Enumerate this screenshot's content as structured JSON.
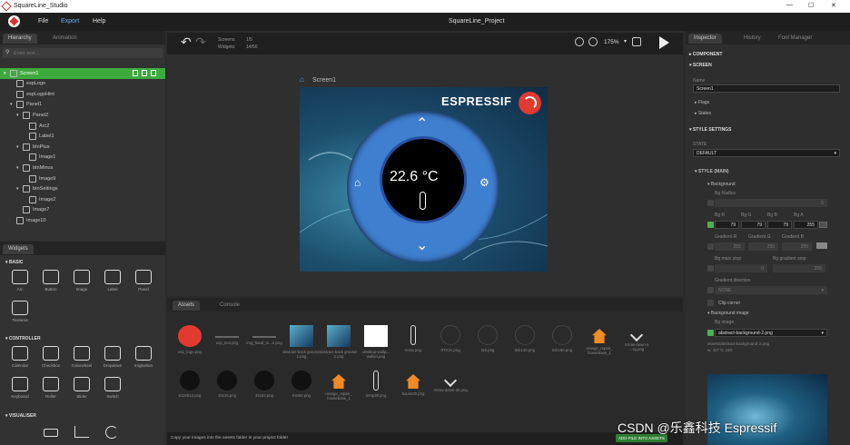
{
  "app": {
    "title": "SquareLine_Studio",
    "project": "SquareLine_Project",
    "menu": [
      "File",
      "Export",
      "Help"
    ]
  },
  "window": {
    "min": "—",
    "max": "☐",
    "close": "✕"
  },
  "left": {
    "tabs": [
      "Hierarchy",
      "Animation"
    ],
    "search_placeholder": "Enter text...",
    "tree": [
      {
        "label": "Screen1",
        "depth": 0,
        "selected": true
      },
      {
        "label": "espLogo",
        "depth": 1
      },
      {
        "label": "espLogoHint",
        "depth": 1
      },
      {
        "label": "Panel1",
        "depth": 1
      },
      {
        "label": "Panel2",
        "depth": 2
      },
      {
        "label": "Arc2",
        "depth": 3
      },
      {
        "label": "Label1",
        "depth": 3
      },
      {
        "label": "btnPlus",
        "depth": 2
      },
      {
        "label": "Image1",
        "depth": 3
      },
      {
        "label": "btnMinus",
        "depth": 2
      },
      {
        "label": "Image9",
        "depth": 3
      },
      {
        "label": "btnSettings",
        "depth": 2
      },
      {
        "label": "Image2",
        "depth": 3
      },
      {
        "label": "Image7",
        "depth": 2
      },
      {
        "label": "Image10",
        "depth": 1
      }
    ],
    "widgets_tab": "Widgets",
    "sections": {
      "basic": "BASIC",
      "controller": "CONTROLLER",
      "visualiser": "VISUALISER"
    },
    "basic": [
      "Arc",
      "Button",
      "Image",
      "Label",
      "Panel",
      "Textarea"
    ],
    "controller": [
      "Calendar",
      "Checkbox",
      "Colorwheel",
      "Dropdown",
      "Imgbutton",
      "Keyboard",
      "Roller",
      "Slider",
      "Switch"
    ]
  },
  "toolbar": {
    "screens_label": "Screens:",
    "screens_val": "1/5",
    "widgets_label": "Widgets:",
    "widgets_val": "14/50",
    "zoom": "175%"
  },
  "canvas": {
    "screen_name": "Screen1",
    "brand": "ESPRESSIF",
    "temp": "22.6 °C"
  },
  "assets": {
    "tabs": [
      "Assets",
      "Console"
    ],
    "row1": [
      "esp_logo.png",
      "esp_text.png",
      "img_hand_m...n.png",
      "abstract-back ground-1.png",
      "abstract-back ground-2.png",
      "desktop-wallp... walker.png",
      "temp.png",
      "RTICK.png",
      "tick.png",
      "tick140.png",
      "tick150.png",
      "orange_repair_ housebase_1",
      "Arrow-down-s ...vg.png"
    ],
    "row2": [
      "512x512.png",
      "16x16.png",
      "32x32.png",
      "64x64.png",
      "orange_repair_ housebase_1",
      "temp30.png",
      "house30.png",
      "Arrow-down-30.png"
    ],
    "hint": "Copy your images into the assets folder in your project folder",
    "add_button": "ADD FILE INTO ASSETS"
  },
  "inspector": {
    "tabs": [
      "Inspector",
      "History",
      "Font Manager"
    ],
    "component": "COMPONENT",
    "screen": "SCREEN",
    "name_label": "Name",
    "name_value": "Screen1",
    "flags": "Flags",
    "states": "States",
    "style_settings": "STYLE SETTINGS",
    "state_label": "STATE",
    "state_value": "DEFAULT",
    "style_main": "STYLE (MAIN)",
    "background": "Background",
    "bg_radius": "Bg Radius",
    "bg_radius_val": "0",
    "rgba_labels": [
      "Bg R",
      "Bg G",
      "Bg B",
      "Bg A"
    ],
    "rgba": [
      "79",
      "79",
      "79",
      "255"
    ],
    "gradient_labels": [
      "Gradient R",
      "Gradient G",
      "Gradient B"
    ],
    "gradient": [
      "255",
      "255",
      "255"
    ],
    "main_stop": "Bg main stop",
    "grad_stop": "Bg gradient stop",
    "main_stop_val": "0",
    "grad_stop_val": "255",
    "grad_dir": "Gradient direction",
    "grad_dir_val": "NONE",
    "clip_corner": "Clip corner",
    "bg_image": "Background image",
    "bg_image_label": "Bg image",
    "bg_image_val": "abstract-background-2.png",
    "preview_name": "assets/abstract-background-2.png",
    "preview_size": "w: 427 h: 240"
  },
  "watermark": "CSDN @乐鑫科技 Espressif"
}
